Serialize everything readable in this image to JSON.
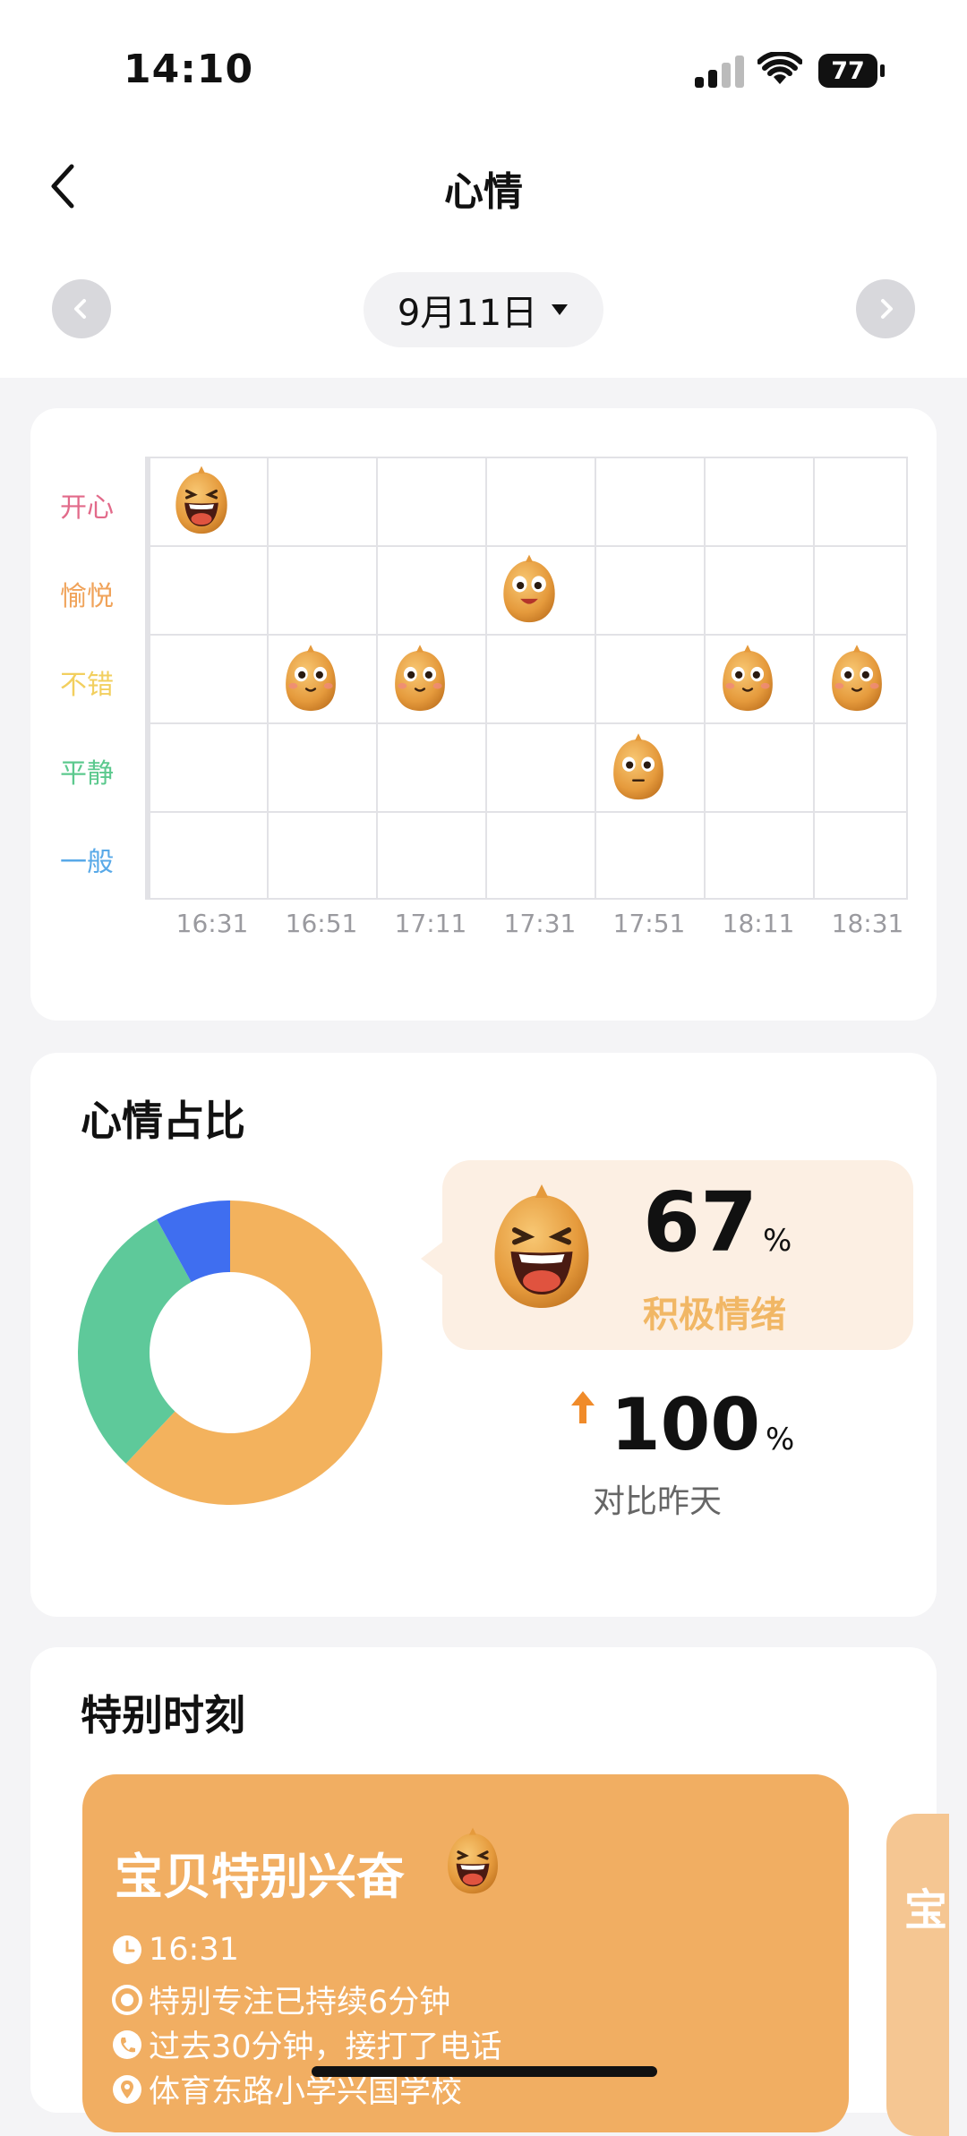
{
  "status_bar": {
    "time": "14:10",
    "battery": "77"
  },
  "header": {
    "title": "心情"
  },
  "date_nav": {
    "date": "9月11日"
  },
  "mood_chart": {
    "y_labels": [
      "开心",
      "愉悦",
      "不错",
      "平静",
      "一般"
    ],
    "y_colors": [
      "#e26a8a",
      "#f0a35a",
      "#f2cf5e",
      "#5cc98e",
      "#58a9e8"
    ],
    "x_labels": [
      "16:31",
      "16:51",
      "17:11",
      "17:31",
      "17:51",
      "18:11",
      "18:31"
    ]
  },
  "chart_data": [
    {
      "type": "scatter",
      "x": [
        "16:31",
        "16:51",
        "17:11",
        "17:31",
        "17:51",
        "18:11",
        "18:31"
      ],
      "y": [
        "开心",
        "不错",
        "不错",
        "愉悦",
        "平静",
        "不错",
        "不错"
      ],
      "y_categories": [
        "开心",
        "愉悦",
        "不错",
        "平静",
        "一般"
      ],
      "grid": true
    },
    {
      "type": "pie",
      "donut": true,
      "values": [
        62,
        30,
        8
      ],
      "colors": [
        "#f3b25d",
        "#5ec99a",
        "#3f6ef0"
      ]
    }
  ],
  "mood_share": {
    "title": "心情占比",
    "positive_pct": "67",
    "pct_sign": "%",
    "positive_label": "积极情绪",
    "compare_pct": "100",
    "compare_label": "对比昨天"
  },
  "special": {
    "title": "特别时刻",
    "card": {
      "title": "宝贝特别兴奋",
      "time": "16:31",
      "focus": "特别专注已持续6分钟",
      "call": "过去30分钟，接打了电话",
      "location": "体育东路小学兴国学校"
    },
    "next_card_peek": "宝"
  }
}
